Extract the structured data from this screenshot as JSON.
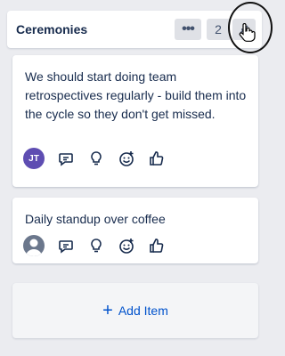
{
  "column": {
    "title": "Ceremonies",
    "more_label": "•••",
    "count": "2"
  },
  "cards": [
    {
      "text": "We should start doing team retrospectives regularly - build them into the cycle so they don't get missed.",
      "avatar_initials": "JT",
      "icons": [
        "comment-icon",
        "lightbulb-icon",
        "add-reaction-icon",
        "thumbs-up-icon"
      ]
    },
    {
      "text": "Daily standup over coffee",
      "avatar_initials": "",
      "icons": [
        "comment-icon",
        "lightbulb-icon",
        "add-reaction-icon",
        "thumbs-up-icon"
      ]
    }
  ],
  "add_item": {
    "label": "Add Item"
  },
  "colors": {
    "board_bg": "#ebecf0",
    "accent": "#0052cc",
    "avatar_jt": "#5e4db2"
  }
}
